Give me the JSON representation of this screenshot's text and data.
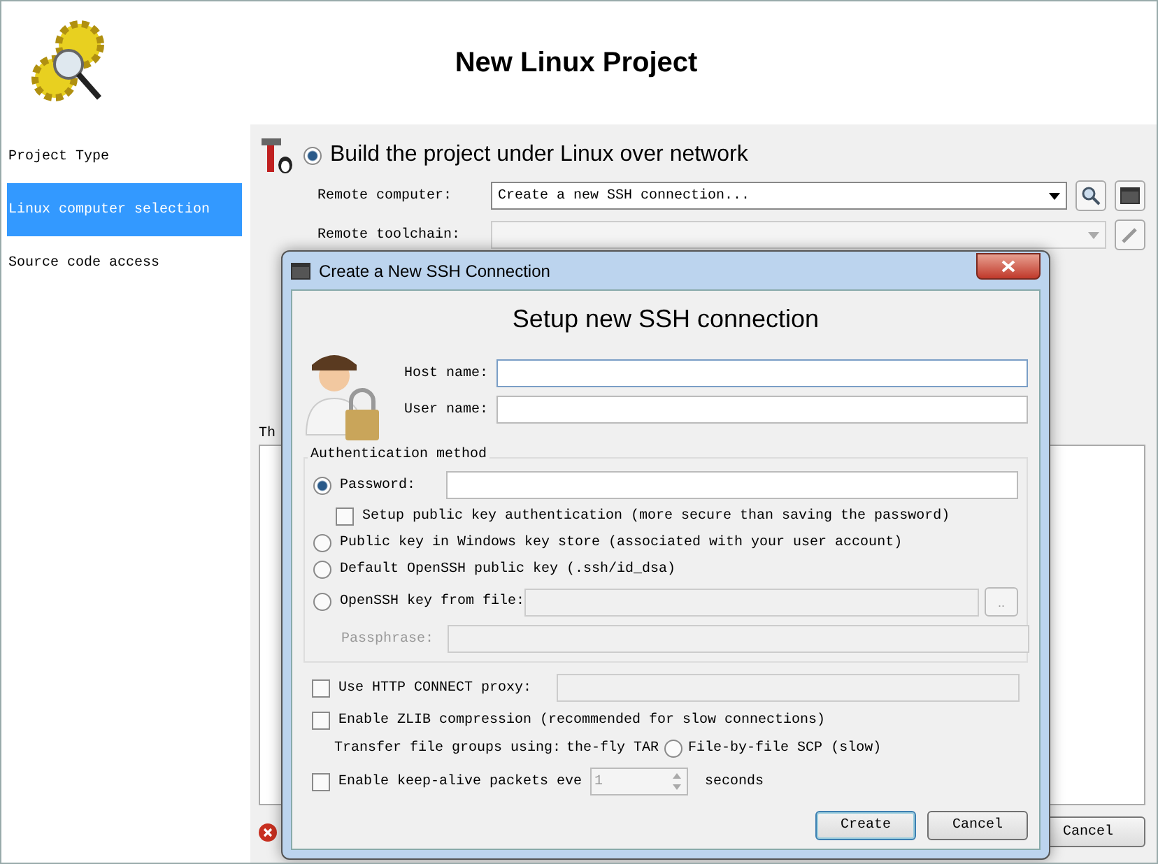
{
  "window": {
    "title": "New Linux Project"
  },
  "sidebar": {
    "items": [
      {
        "label": "Project Type",
        "selected": false
      },
      {
        "label": "Linux computer selection",
        "selected": true
      },
      {
        "label": "Source code access",
        "selected": false
      }
    ]
  },
  "build_option": {
    "label": "Build the project under Linux over network",
    "selected": true
  },
  "remote_computer": {
    "label": "Remote computer:",
    "value": "Create a new SSH connection..."
  },
  "remote_toolchain": {
    "label": "Remote toolchain:"
  },
  "partial_text": "Th",
  "background_cancel": "Cancel",
  "dialog": {
    "title": "Create a New SSH Connection",
    "heading": "Setup new SSH connection",
    "host_label": "Host name:",
    "user_label": "User name:",
    "auth_group": "Authentication method",
    "auth_options": [
      {
        "kind": "field",
        "label": "Password:",
        "selected": true
      },
      {
        "kind": "plain",
        "label": "Public key in Windows key store (associated with your user account)",
        "selected": false
      },
      {
        "kind": "plain",
        "label": "Default OpenSSH public key (.ssh/id_dsa)",
        "selected": false
      },
      {
        "kind": "file",
        "label": "OpenSSH key from file:",
        "selected": false,
        "button": ".."
      }
    ],
    "setup_public_key": {
      "label": "Setup public key authentication (more secure than saving the password)",
      "checked": false
    },
    "passphrase": {
      "label": "Passphrase:",
      "disabled": true
    },
    "proxy": {
      "label": "Use HTTP CONNECT proxy:",
      "checked": false
    },
    "zlib": {
      "label": "Enable ZLIB compression (recommended for slow connections)",
      "checked": false
    },
    "transfer": {
      "label": "Transfer file groups using:",
      "cut_option": "the-fly TAR",
      "options": [
        {
          "label": "File-by-file SCP (slow)",
          "selected": false
        }
      ]
    },
    "keepalive": {
      "label": "Enable keep-alive packets eve",
      "checked": false,
      "value": "1",
      "unit": "seconds"
    },
    "buttons": [
      {
        "label": "Create",
        "default": true
      },
      {
        "label": "Cancel",
        "default": false
      }
    ]
  }
}
